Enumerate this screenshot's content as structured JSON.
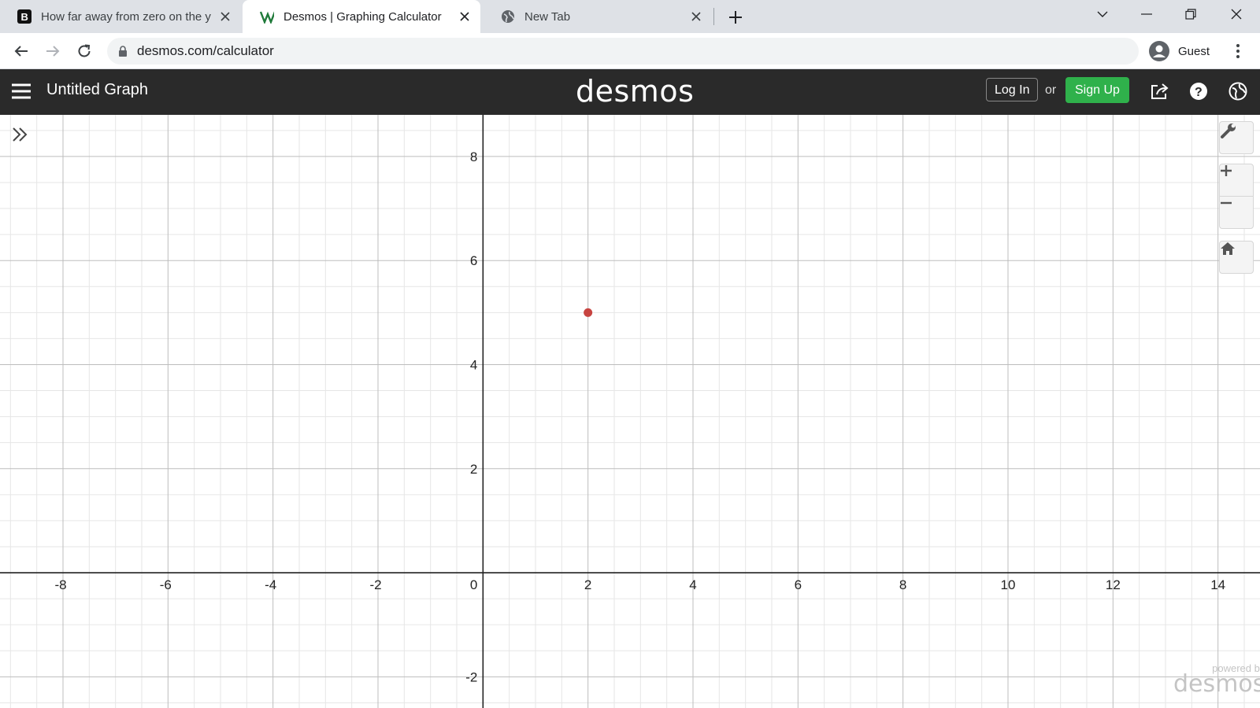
{
  "browser": {
    "tabs": [
      {
        "title": "How far away from zero on the y",
        "active": false
      },
      {
        "title": "Desmos | Graphing Calculator",
        "active": true
      },
      {
        "title": "New Tab",
        "active": false
      }
    ],
    "url": "desmos.com/calculator",
    "profile_label": "Guest"
  },
  "header": {
    "graph_title": "Untitled Graph",
    "logo": "desmos",
    "login_label": "Log In",
    "or_label": "or",
    "signup_label": "Sign Up"
  },
  "graph": {
    "x_range": [
      -9.2,
      14.8
    ],
    "y_range": [
      -2.6,
      8.8
    ],
    "x_tick_labels": [
      "-8",
      "-6",
      "-4",
      "-2",
      "0",
      "2",
      "4",
      "6",
      "8",
      "10",
      "12",
      "14"
    ],
    "y_tick_labels": [
      "-2",
      "2",
      "4",
      "6",
      "8"
    ],
    "major_step": 2,
    "minor_step": 0.5,
    "points": [
      {
        "x": 2,
        "y": 5,
        "color": "#c74440"
      }
    ]
  },
  "watermark": {
    "small": "powered by",
    "big": "desmos"
  },
  "colors": {
    "header_bg": "#2a2a2a",
    "signup_green": "#2fb14b",
    "point_red": "#c74440"
  },
  "icons": [
    "hamburger-icon",
    "share-icon",
    "help-icon",
    "globe-icon",
    "expand-icon",
    "wrench-icon",
    "zoom-in-icon",
    "zoom-out-icon",
    "home-icon"
  ]
}
